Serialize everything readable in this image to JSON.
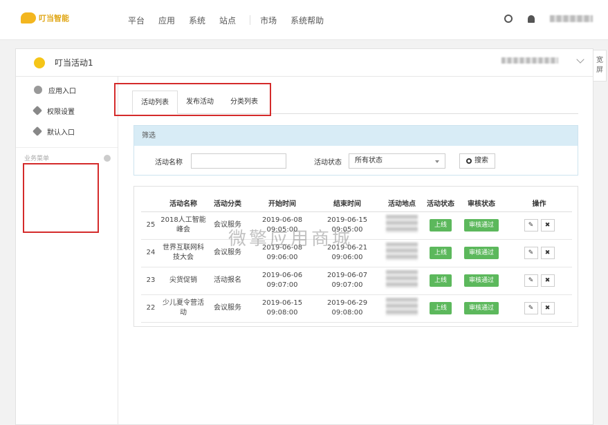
{
  "topbar": {
    "logo_text": "叮当智能",
    "nav": [
      "平台",
      "应用",
      "系统",
      "站点",
      "市场",
      "系统帮助"
    ]
  },
  "panel": {
    "app_name": "叮当活动1",
    "side_tab": "宽屏"
  },
  "sidebar": {
    "items": [
      {
        "label": "应用入口",
        "icon": "comment-icon"
      },
      {
        "label": "权限设置",
        "icon": "gear-icon"
      },
      {
        "label": "默认入口",
        "icon": "gear-icon"
      }
    ],
    "section_label": "业务菜单"
  },
  "tabs": [
    "活动列表",
    "发布活动",
    "分类列表"
  ],
  "filter": {
    "title": "筛选",
    "name_label": "活动名称",
    "name_value": "",
    "status_label": "活动状态",
    "status_selected": "所有状态",
    "search_label": "搜索"
  },
  "table": {
    "headers": [
      "",
      "活动名称",
      "活动分类",
      "开始时间",
      "结束时间",
      "活动地点",
      "活动状态",
      "审核状态",
      "操作"
    ],
    "rows": [
      {
        "id": "25",
        "name": "2018人工智能峰会",
        "category": "会议服务",
        "start": "2019-06-08 09:05:00",
        "end": "2019-06-15 09:05:00",
        "status": "上线",
        "review": "审核通过"
      },
      {
        "id": "24",
        "name": "世界互联网科技大会",
        "category": "会议服务",
        "start": "2019-06-08 09:06:00",
        "end": "2019-06-21 09:06:00",
        "status": "上线",
        "review": "审核通过"
      },
      {
        "id": "23",
        "name": "尖货促销",
        "category": "活动报名",
        "start": "2019-06-06 09:07:00",
        "end": "2019-06-07 09:07:00",
        "status": "上线",
        "review": "审核通过"
      },
      {
        "id": "22",
        "name": "少儿夏令营活动",
        "category": "会议服务",
        "start": "2019-06-15 09:08:00",
        "end": "2019-06-29 09:08:00",
        "status": "上线",
        "review": "审核通过"
      }
    ]
  },
  "watermark": "微擎应用商城",
  "colors": {
    "accent_red": "#d42a2a",
    "badge_green": "#5cb85c",
    "filter_head": "#d8ecf6",
    "logo": "#f3b61f"
  }
}
